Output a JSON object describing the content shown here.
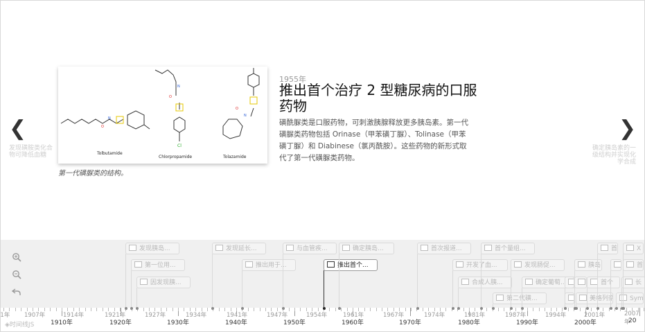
{
  "nav": {
    "prev_arrow": "❮",
    "next_arrow": "❯",
    "prev_peek": "发现磺胺类化合物可降低血糖",
    "next_peek": "确定胰岛素的一级结构并实现化学合成"
  },
  "slide": {
    "year": "1955年",
    "title": "推出首个治疗 2 型糖尿病的口服药物",
    "body": "磺酰脲类是口服药物，可刺激胰腺释放更多胰岛素。第一代磺脲类药物包括 Orinase（甲苯磺丁脲）、Tolinase（甲苯磺丁脲）和 Diabinese（氯丙酰胺）。这些药物的新形式取代了第一代磺脲类药物。",
    "caption": "第一代磺脲类的结构。",
    "molecules": [
      "Tolbutamide",
      "Chlorpropamide",
      "Tolazamide"
    ]
  },
  "zoom": {
    "in_icon": "zoom-in-icon",
    "out_icon": "zoom-out-icon",
    "back_icon": "back-icon"
  },
  "markers": [
    {
      "label": "发现胰岛...",
      "active": false
    },
    {
      "label": "第一位用...",
      "active": false
    },
    {
      "label": "因发现胰...",
      "active": false
    },
    {
      "label": "发现延长...",
      "active": false
    },
    {
      "label": "推出用于...",
      "active": false
    },
    {
      "label": "与血管疾...",
      "active": false
    },
    {
      "label": "推出首个...",
      "active": true
    },
    {
      "label": "确定胰岛...",
      "active": false
    },
    {
      "label": "首次报道...",
      "active": false
    },
    {
      "label": "开发了血...",
      "active": false
    },
    {
      "label": "合成人胰...",
      "active": false
    },
    {
      "label": "首个量组...",
      "active": false
    },
    {
      "label": "发现肠促...",
      "active": false
    },
    {
      "label": "确定葡萄...",
      "active": false
    },
    {
      "label": "第二代磺...",
      "active": false
    },
    {
      "label": "首",
      "active": false
    },
    {
      "label": "首二代",
      "active": false
    },
    {
      "label": "X",
      "active": false
    },
    {
      "label": "胰岛",
      "active": false
    },
    {
      "label": "人",
      "active": false
    },
    {
      "label": "首",
      "active": false
    },
    {
      "label": "首个",
      "active": false
    },
    {
      "label": "首个",
      "active": false
    },
    {
      "label": "长",
      "active": false
    },
    {
      "label": "美格列奈",
      "active": false
    },
    {
      "label": "Sym",
      "active": false
    },
    {
      "label": "第",
      "active": false
    }
  ],
  "axis": {
    "major": [
      "1910年",
      "1920年",
      "1930年",
      "1940年",
      "1950年",
      "1960年",
      "1970年",
      "1980年",
      "1990年",
      "2000年",
      "20"
    ],
    "minor": [
      "01年",
      "1907年",
      "1914年",
      "1921年",
      "1927年",
      "1934年",
      "1941年",
      "1947年",
      "1954年",
      "1961年",
      "1967年",
      "1974年",
      "1981年",
      "1987年",
      "1994年",
      "2001年",
      "2007年"
    ]
  },
  "brand": "◈时间线JS"
}
